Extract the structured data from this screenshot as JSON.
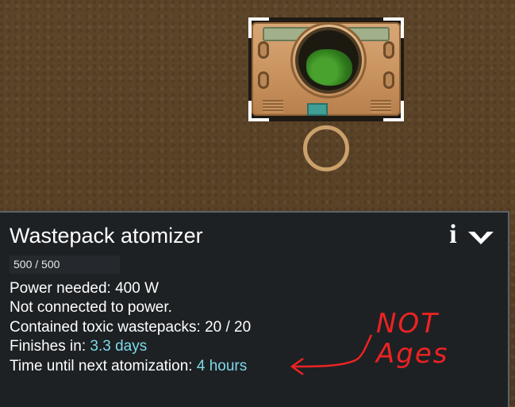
{
  "game": {
    "building_name": "Wastepack atomizer",
    "hitpoints": "500 / 500",
    "stats": [
      {
        "label": "Power needed: ",
        "value": "400 W"
      },
      {
        "label": "Not connected to power.",
        "value": ""
      },
      {
        "label": "Contained toxic wastepacks: ",
        "value": "20 / 20"
      },
      {
        "label": "Finishes in: ",
        "value": "3.3 days"
      },
      {
        "label": "Time until next atomization: ",
        "value": "4 hours"
      }
    ],
    "annotation": {
      "line1": "NOT",
      "line2": "Ages"
    }
  },
  "icons": {
    "info": "info-icon",
    "dropdown": "chevron-down-icon"
  },
  "colors": {
    "panel_bg": "#1d2124",
    "highlight_value": "#7ed9e8",
    "annotation": "#ee2222",
    "ground": "#5a4327"
  }
}
